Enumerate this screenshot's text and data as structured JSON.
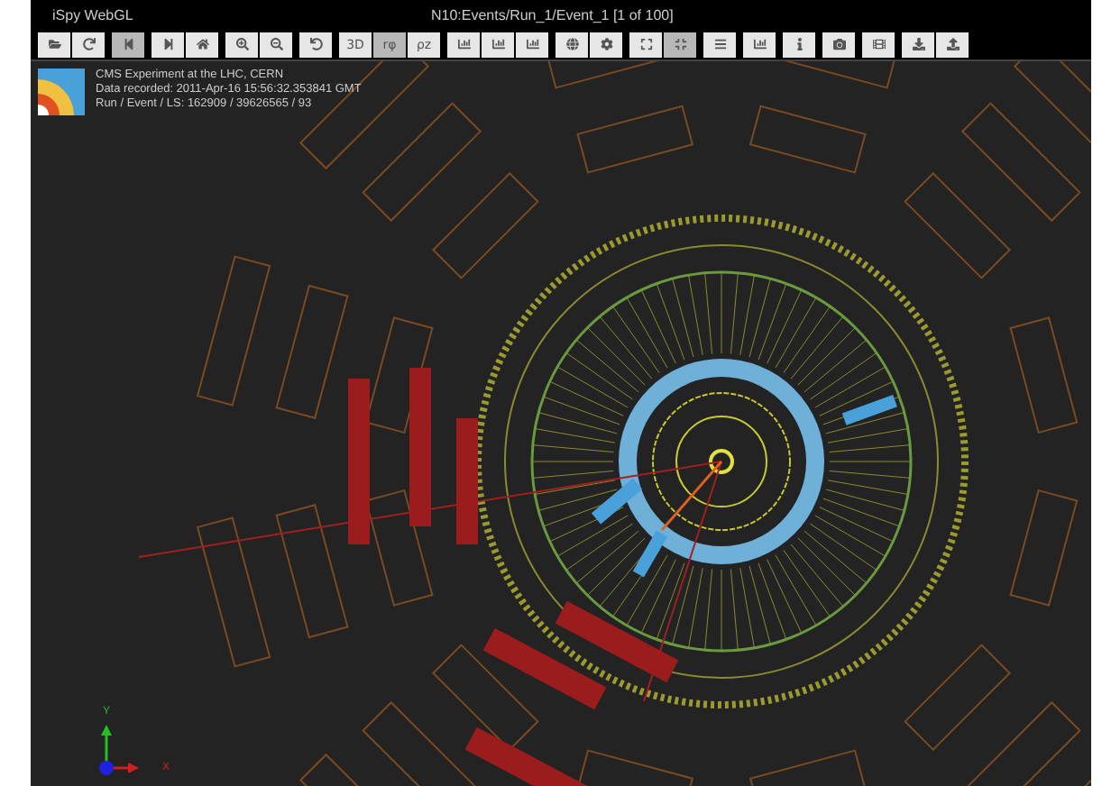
{
  "window": {
    "app_title": "iSpy WebGL",
    "event_title": "N10:Events/Run_1/Event_1 [1 of 100]"
  },
  "toolbar": [
    {
      "kind": "icon",
      "selected": false
    },
    {
      "kind": "icon",
      "selected": false
    },
    {
      "kind": "icon",
      "selected": true
    },
    {
      "kind": "icon",
      "selected": false
    },
    {
      "kind": "icon",
      "selected": false
    },
    {
      "kind": "icon",
      "selected": false
    },
    {
      "kind": "icon",
      "selected": false
    },
    {
      "kind": "icon",
      "selected": false
    },
    {
      "kind": "text",
      "label": "3D",
      "selected": false
    },
    {
      "kind": "text",
      "label": "rφ",
      "selected": true
    },
    {
      "kind": "text",
      "label": "ρz",
      "selected": false
    },
    {
      "kind": "icon",
      "selected": false
    },
    {
      "kind": "icon",
      "selected": false
    },
    {
      "kind": "icon",
      "selected": false
    },
    {
      "kind": "icon",
      "selected": false
    },
    {
      "kind": "icon",
      "selected": false
    },
    {
      "kind": "icon",
      "selected": false
    },
    {
      "kind": "icon",
      "selected": true
    },
    {
      "kind": "icon",
      "selected": false
    },
    {
      "kind": "icon",
      "selected": false
    },
    {
      "kind": "icon",
      "selected": false
    },
    {
      "kind": "icon",
      "selected": false
    },
    {
      "kind": "icon",
      "selected": false
    },
    {
      "kind": "icon",
      "selected": false
    },
    {
      "kind": "icon",
      "selected": false
    }
  ],
  "event_info": {
    "lines": [
      "CMS Experiment at the LHC, CERN",
      "Data recorded: 2011-Apr-16 15:56:32.353841 GMT",
      "Run / Event / LS: 162909 / 39626565 / 93"
    ]
  },
  "axes": {
    "y_label": "Y",
    "x_label": "X"
  }
}
